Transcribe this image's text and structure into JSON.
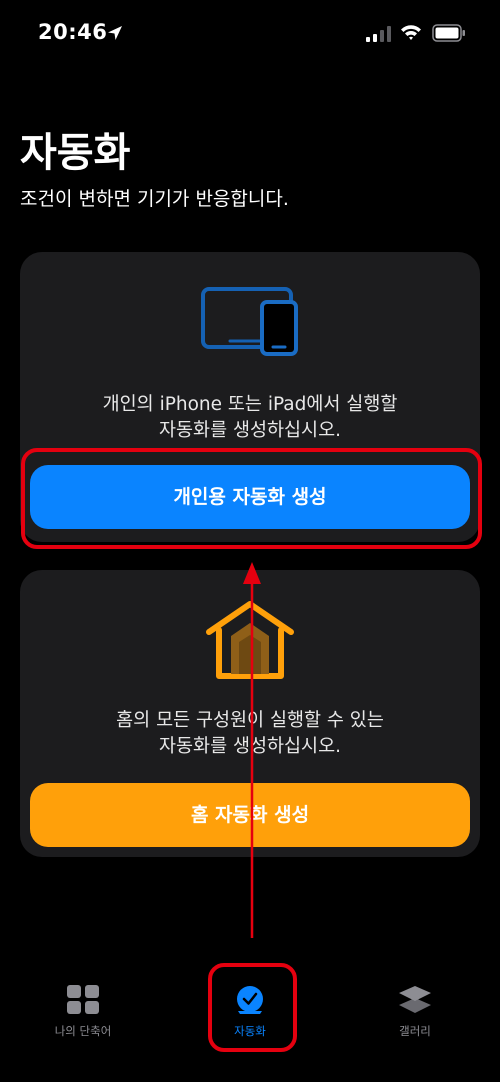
{
  "status_bar": {
    "time": "20:46"
  },
  "header": {
    "title": "자동화",
    "subtitle": "조건이 변하면 기기가 반응합니다."
  },
  "personal_card": {
    "description_line1": "개인의 iPhone 또는 iPad에서 실행할",
    "description_line2": "자동화를 생성하십시오.",
    "button_label": "개인용 자동화 생성",
    "icon": "devices-icon",
    "accent_color": "#0a84ff"
  },
  "home_card": {
    "description_line1": "홈의 모든 구성원이 실행할 수 있는",
    "description_line2": "자동화를 생성하십시오.",
    "button_label": "홈 자동화 생성",
    "icon": "home-icon",
    "accent_color": "#ffa00a"
  },
  "tab_bar": {
    "tabs": [
      {
        "label": "나의 단축어",
        "icon": "grid-icon",
        "active": false
      },
      {
        "label": "자동화",
        "icon": "clock-check-icon",
        "active": true
      },
      {
        "label": "갤러리",
        "icon": "layers-icon",
        "active": false
      }
    ]
  },
  "annotation_color": "#e5000f"
}
